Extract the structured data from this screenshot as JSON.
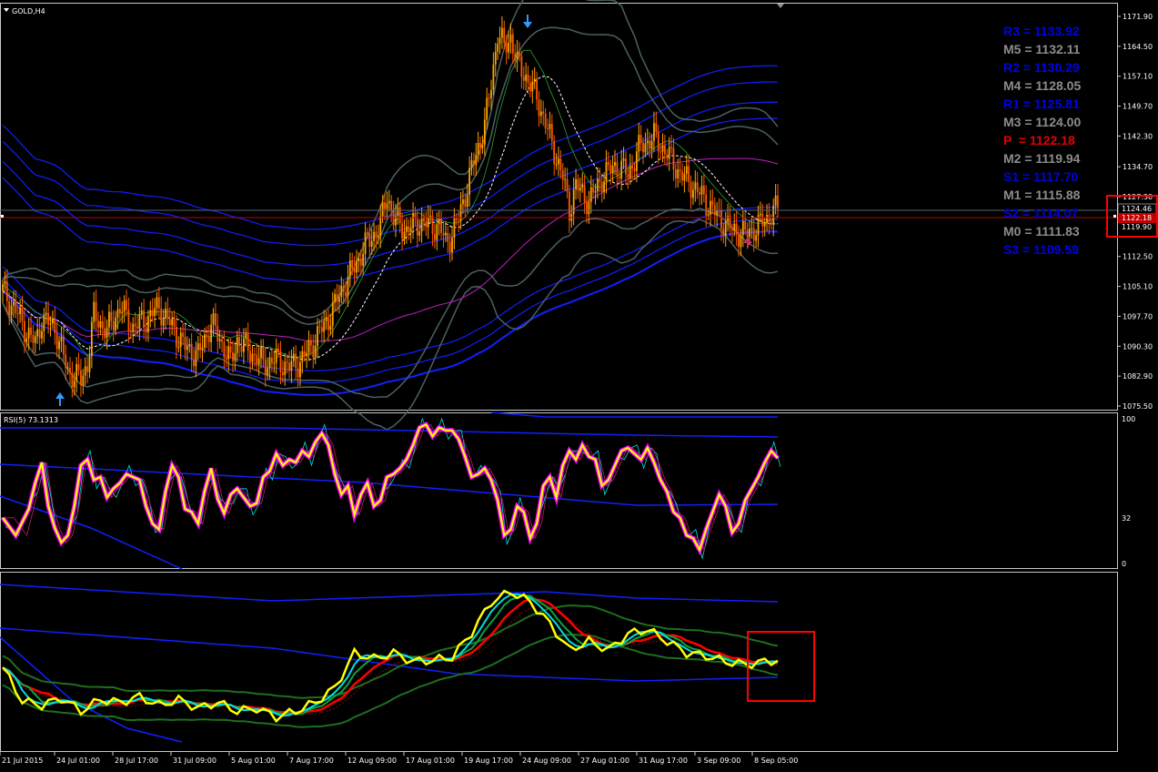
{
  "window": {
    "symbol_title": "GOLD,H4",
    "rsi_title": "RSI(5) 73.1313"
  },
  "colors": {
    "background": "#000000",
    "axis": "#c8c8c8",
    "bull_candle": "#ffa500",
    "bear_candle": "#ff5a00",
    "pivot_resistance": "#0000e6",
    "pivot_mid": "#8c8c8c",
    "pivot_point": "#e60000",
    "band_blue": "#1020ff",
    "band_gray": "#4c6060",
    "ma_magenta": "#c020c0",
    "rsi_yellow": "#ffff00",
    "rsi_magenta": "#ff00ff",
    "rsi_cyan": "#00e0e0",
    "osc_red": "#ff0000",
    "osc_green": "#1e6e1e",
    "highlight_box": "#ff0000",
    "price_line": "#c00000"
  },
  "pivots": [
    {
      "label": "R3 = 1133.92",
      "kind": "resistance"
    },
    {
      "label": "M5 = 1132.11",
      "kind": "mid"
    },
    {
      "label": "R2 = 1130.29",
      "kind": "resistance"
    },
    {
      "label": "M4 = 1128.05",
      "kind": "mid"
    },
    {
      "label": "R1 = 1125.81",
      "kind": "resistance"
    },
    {
      "label": "M3 = 1124.00",
      "kind": "mid"
    },
    {
      "label": "P  = 1122.18",
      "kind": "pivot"
    },
    {
      "label": "M2 = 1119.94",
      "kind": "mid"
    },
    {
      "label": "S1 = 1117.70",
      "kind": "resistance"
    },
    {
      "label": "M1 = 1115.88",
      "kind": "mid"
    },
    {
      "label": "S2 = 1114.07",
      "kind": "resistance"
    },
    {
      "label": "M0 = 1111.83",
      "kind": "mid"
    },
    {
      "label": "S3 = 1109.59",
      "kind": "resistance"
    }
  ],
  "chart_data": [
    {
      "type": "candlestick",
      "title": "GOLD,H4",
      "y_ticks": [
        1171.9,
        1164.5,
        1157.1,
        1149.7,
        1142.3,
        1134.7,
        1127.3,
        1112.5,
        1105.1,
        1097.7,
        1090.3,
        1082.9,
        1075.5
      ],
      "ylim": [
        1075.5,
        1171.9
      ],
      "price_labels": [
        "1124.46",
        "1122.18",
        "1119.90"
      ],
      "current_price": 1124.46,
      "pivot_point": 1122.18,
      "x_ticks": [
        "21 Jul 2015",
        "24 Jul 01:00",
        "28 Jul 17:00",
        "31 Jul 09:00",
        "5 Aug 01:00",
        "7 Aug 17:00",
        "12 Aug 09:00",
        "17 Aug 01:00",
        "19 Aug 17:00",
        "24 Aug 09:00",
        "27 Aug 01:00",
        "31 Aug 17:00",
        "3 Sep 09:00",
        "8 Sep 05:00"
      ],
      "close_path": [
        [
          0,
          1104
        ],
        [
          2,
          1099
        ],
        [
          4,
          1093
        ],
        [
          5,
          1091
        ],
        [
          6,
          1097
        ],
        [
          8,
          1095
        ],
        [
          10,
          1084
        ],
        [
          12,
          1082
        ],
        [
          13,
          1086
        ],
        [
          14,
          1098
        ],
        [
          16,
          1094
        ],
        [
          18,
          1100
        ],
        [
          20,
          1095
        ],
        [
          22,
          1097
        ],
        [
          24,
          1100
        ],
        [
          26,
          1095
        ],
        [
          28,
          1090
        ],
        [
          30,
          1088
        ],
        [
          32,
          1096
        ],
        [
          34,
          1090
        ],
        [
          35,
          1086
        ],
        [
          36,
          1092
        ],
        [
          38,
          1089
        ],
        [
          40,
          1086
        ],
        [
          42,
          1087
        ],
        [
          44,
          1085
        ],
        [
          46,
          1087
        ],
        [
          48,
          1092
        ],
        [
          50,
          1097
        ],
        [
          52,
          1104
        ],
        [
          54,
          1110
        ],
        [
          56,
          1116
        ],
        [
          58,
          1120
        ],
        [
          59,
          1128
        ],
        [
          60,
          1122
        ],
        [
          62,
          1119
        ],
        [
          64,
          1121
        ],
        [
          66,
          1120
        ],
        [
          67,
          1120
        ],
        [
          68,
          1116
        ],
        [
          69,
          1118
        ],
        [
          70,
          1122
        ],
        [
          72,
          1134
        ],
        [
          74,
          1145
        ],
        [
          75,
          1155
        ],
        [
          76,
          1168
        ],
        [
          77,
          1164
        ],
        [
          78,
          1167
        ],
        [
          79,
          1160
        ],
        [
          80,
          1158
        ],
        [
          82,
          1152
        ],
        [
          84,
          1142
        ],
        [
          86,
          1132
        ],
        [
          87,
          1124
        ],
        [
          88,
          1130
        ],
        [
          90,
          1126
        ],
        [
          92,
          1132
        ],
        [
          94,
          1135
        ],
        [
          96,
          1133
        ],
        [
          98,
          1140
        ],
        [
          100,
          1142
        ],
        [
          102,
          1138
        ],
        [
          104,
          1133
        ],
        [
          106,
          1130
        ],
        [
          108,
          1126
        ],
        [
          110,
          1122
        ],
        [
          112,
          1119
        ],
        [
          114,
          1118
        ],
        [
          116,
          1120
        ],
        [
          118,
          1123
        ],
        [
          119,
          1124.5
        ]
      ]
    },
    {
      "type": "line",
      "title": "RSI(5) 73.1313",
      "ylim": [
        0,
        100
      ],
      "y_ticks": [
        100,
        32,
        0
      ],
      "series_rsi": [
        [
          0,
          32
        ],
        [
          2,
          20
        ],
        [
          4,
          38
        ],
        [
          5,
          56
        ],
        [
          6,
          70
        ],
        [
          7,
          40
        ],
        [
          8,
          25
        ],
        [
          9,
          15
        ],
        [
          10,
          20
        ],
        [
          11,
          40
        ],
        [
          12,
          68
        ],
        [
          13,
          72
        ],
        [
          14,
          58
        ],
        [
          15,
          60
        ],
        [
          16,
          46
        ],
        [
          17,
          52
        ],
        [
          18,
          56
        ],
        [
          19,
          62
        ],
        [
          20,
          60
        ],
        [
          21,
          58
        ],
        [
          22,
          40
        ],
        [
          23,
          28
        ],
        [
          24,
          24
        ],
        [
          25,
          50
        ],
        [
          26,
          68
        ],
        [
          27,
          60
        ],
        [
          28,
          38
        ],
        [
          29,
          36
        ],
        [
          30,
          28
        ],
        [
          31,
          50
        ],
        [
          32,
          66
        ],
        [
          33,
          45
        ],
        [
          34,
          35
        ],
        [
          35,
          48
        ],
        [
          36,
          52
        ],
        [
          37,
          46
        ],
        [
          38,
          40
        ],
        [
          39,
          42
        ],
        [
          40,
          60
        ],
        [
          41,
          64
        ],
        [
          42,
          76
        ],
        [
          43,
          68
        ],
        [
          44,
          72
        ],
        [
          45,
          70
        ],
        [
          46,
          78
        ],
        [
          47,
          74
        ],
        [
          48,
          84
        ],
        [
          49,
          90
        ],
        [
          50,
          82
        ],
        [
          51,
          62
        ],
        [
          52,
          48
        ],
        [
          53,
          54
        ],
        [
          54,
          34
        ],
        [
          55,
          48
        ],
        [
          56,
          56
        ],
        [
          57,
          40
        ],
        [
          58,
          44
        ],
        [
          59,
          60
        ],
        [
          60,
          62
        ],
        [
          61,
          66
        ],
        [
          62,
          72
        ],
        [
          63,
          82
        ],
        [
          64,
          94
        ],
        [
          65,
          96
        ],
        [
          66,
          88
        ],
        [
          67,
          94
        ],
        [
          68,
          92
        ],
        [
          69,
          92
        ],
        [
          70,
          86
        ],
        [
          71,
          74
        ],
        [
          72,
          60
        ],
        [
          73,
          62
        ],
        [
          74,
          66
        ],
        [
          75,
          58
        ],
        [
          76,
          44
        ],
        [
          77,
          20
        ],
        [
          78,
          24
        ],
        [
          79,
          40
        ],
        [
          80,
          36
        ],
        [
          81,
          18
        ],
        [
          82,
          28
        ],
        [
          83,
          54
        ],
        [
          84,
          60
        ],
        [
          85,
          46
        ],
        [
          86,
          68
        ],
        [
          87,
          78
        ],
        [
          88,
          72
        ],
        [
          89,
          82
        ],
        [
          90,
          74
        ],
        [
          91,
          72
        ],
        [
          92,
          54
        ],
        [
          93,
          58
        ],
        [
          94,
          68
        ],
        [
          95,
          78
        ],
        [
          96,
          80
        ],
        [
          97,
          76
        ],
        [
          98,
          72
        ],
        [
          99,
          80
        ],
        [
          100,
          70
        ],
        [
          101,
          58
        ],
        [
          102,
          50
        ],
        [
          103,
          36
        ],
        [
          104,
          32
        ],
        [
          105,
          20
        ],
        [
          106,
          18
        ],
        [
          107,
          10
        ],
        [
          108,
          24
        ],
        [
          109,
          36
        ],
        [
          110,
          48
        ],
        [
          111,
          40
        ],
        [
          112,
          22
        ],
        [
          113,
          28
        ],
        [
          114,
          44
        ],
        [
          115,
          52
        ],
        [
          116,
          60
        ],
        [
          117,
          70
        ],
        [
          118,
          78
        ],
        [
          119,
          73
        ]
      ]
    },
    {
      "type": "line",
      "title": "",
      "series_osc": [
        [
          0,
          0.48
        ],
        [
          3,
          0.25
        ],
        [
          6,
          0.22
        ],
        [
          9,
          0.27
        ],
        [
          12,
          0.18
        ],
        [
          15,
          0.26
        ],
        [
          18,
          0.24
        ],
        [
          21,
          0.28
        ],
        [
          24,
          0.22
        ],
        [
          27,
          0.26
        ],
        [
          30,
          0.2
        ],
        [
          33,
          0.24
        ],
        [
          36,
          0.18
        ],
        [
          39,
          0.2
        ],
        [
          42,
          0.14
        ],
        [
          45,
          0.18
        ],
        [
          48,
          0.24
        ],
        [
          51,
          0.34
        ],
        [
          54,
          0.58
        ],
        [
          57,
          0.54
        ],
        [
          60,
          0.58
        ],
        [
          63,
          0.52
        ],
        [
          66,
          0.53
        ],
        [
          69,
          0.55
        ],
        [
          72,
          0.72
        ],
        [
          75,
          0.93
        ],
        [
          78,
          1.0
        ],
        [
          81,
          0.93
        ],
        [
          84,
          0.78
        ],
        [
          87,
          0.6
        ],
        [
          90,
          0.66
        ],
        [
          93,
          0.6
        ],
        [
          96,
          0.71
        ],
        [
          99,
          0.74
        ],
        [
          102,
          0.66
        ],
        [
          105,
          0.58
        ],
        [
          108,
          0.56
        ],
        [
          111,
          0.52
        ],
        [
          114,
          0.5
        ],
        [
          117,
          0.52
        ],
        [
          119,
          0.53
        ]
      ]
    }
  ]
}
